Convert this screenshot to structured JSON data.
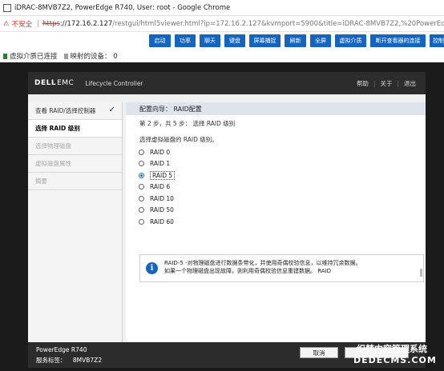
{
  "window": {
    "title": "iDRAC-8MVB7Z2, PowerEdge R740, User: root - Google Chrome"
  },
  "address": {
    "insecure_label": "不安全",
    "scheme": "https",
    "url_host": "://172.16.2.127",
    "url_rest": "/restgui/html5viewer.html?ip=172.16.2.127&kvmport=5900&title=iDRAC-8MVB7Z2,%20PowerEdge"
  },
  "toolbar": {
    "buttons": [
      "启动",
      "功率",
      "聊天",
      "键盘",
      "屏幕捕捉",
      "刷新",
      "全屏",
      "虚拟介质",
      "断开查看器的连接",
      "控制"
    ]
  },
  "status": {
    "media_status": "虚拟介质已连接",
    "mapped_devices": "映射的设备：  0"
  },
  "lc": {
    "brand_dell": "DELL",
    "brand_emc": "EMC",
    "product": "Lifecycle Controller",
    "help": "帮助",
    "about": "关于",
    "exit": "退出",
    "sidebar": [
      "查看 RAID/选择控制器",
      "选择 RAID 级别",
      "选择物理磁盘",
      "虚拟磁盘属性",
      "摘要"
    ],
    "wizard_title": "配置向导：  RAID配置",
    "step": "第 2 步，共 5 步：  选择 RAID 级别",
    "prompt": "选择虚拟磁盘的 RAID 级别。",
    "raid_levels": [
      "RAID 0",
      "RAID 1",
      "RAID 5",
      "RAID 6",
      "RAID 10",
      "RAID 50",
      "RAID 60"
    ],
    "selected_level": "RAID 5",
    "info_line1": "RAID-5 -对物理磁盘进行数据条带化，并使用奇偶校验信息，以维持冗余数据。",
    "info_line2": "如果一个物理磁盘出现故障，则利用奇偶校验信息重建数据。 RAID",
    "model": "PowerEdge R740",
    "service_tag_label": "服务标签：",
    "service_tag": "8MVB7Z2",
    "cancel": "取消"
  },
  "watermark": {
    "line1": "织梦内容管理系统",
    "line2": "DEDECMS.COM"
  },
  "colors": {
    "accent_blue": "#1565c0",
    "warning_red": "#d93025",
    "header_dark": "#2c2c2c"
  }
}
